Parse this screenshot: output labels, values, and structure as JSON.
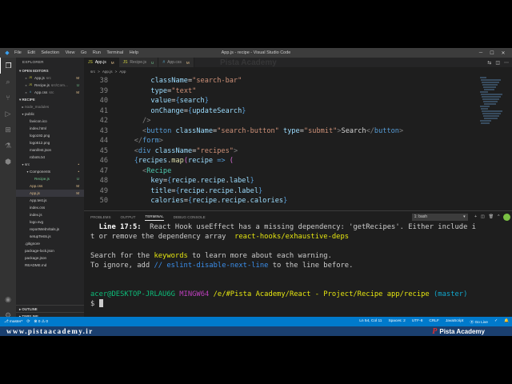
{
  "titlebar": {
    "menu": [
      "File",
      "Edit",
      "Selection",
      "View",
      "Go",
      "Run",
      "Terminal",
      "Help"
    ],
    "title": "App.js - recipe - Visual Studio Code"
  },
  "sidebar": {
    "header": "EXPLORER",
    "open_editors": {
      "title": "OPEN EDITORS",
      "items": [
        {
          "name": "App.js",
          "hint": "src",
          "badge": "M",
          "icon": "js"
        },
        {
          "name": "Recipe.js",
          "hint": "src\\Com...",
          "badge": "U",
          "icon": "js"
        },
        {
          "name": "App.css",
          "hint": "src",
          "badge": "M",
          "icon": "css"
        }
      ]
    },
    "project": {
      "title": "RECIPE",
      "items": [
        {
          "name": "node_modules",
          "type": "folder",
          "depth": 1
        },
        {
          "name": "public",
          "type": "folder-open",
          "depth": 1
        },
        {
          "name": "favicon.ico",
          "type": "file",
          "depth": 2
        },
        {
          "name": "index.html",
          "type": "file",
          "depth": 2
        },
        {
          "name": "logo192.png",
          "type": "file",
          "depth": 2
        },
        {
          "name": "logo512.png",
          "type": "file",
          "depth": 2
        },
        {
          "name": "manifest.json",
          "type": "file",
          "depth": 2
        },
        {
          "name": "robots.txt",
          "type": "file",
          "depth": 2
        },
        {
          "name": "src",
          "type": "folder-open",
          "depth": 1,
          "badge": "•"
        },
        {
          "name": "Components",
          "type": "folder-open",
          "depth": 2,
          "badge": "•"
        },
        {
          "name": "Recipe.js",
          "type": "file",
          "depth": 3,
          "badge": "U"
        },
        {
          "name": "App.css",
          "type": "file",
          "depth": 2,
          "badge": "M"
        },
        {
          "name": "App.js",
          "type": "file",
          "depth": 2,
          "badge": "M",
          "selected": true
        },
        {
          "name": "App.test.js",
          "type": "file",
          "depth": 2
        },
        {
          "name": "index.css",
          "type": "file",
          "depth": 2
        },
        {
          "name": "index.js",
          "type": "file",
          "depth": 2
        },
        {
          "name": "logo.svg",
          "type": "file",
          "depth": 2
        },
        {
          "name": "reportWebVitals.js",
          "type": "file",
          "depth": 2
        },
        {
          "name": "setupTests.js",
          "type": "file",
          "depth": 2
        },
        {
          "name": ".gitignore",
          "type": "file",
          "depth": 1
        },
        {
          "name": "package-lock.json",
          "type": "file",
          "depth": 1
        },
        {
          "name": "package.json",
          "type": "file",
          "depth": 1
        },
        {
          "name": "README.md",
          "type": "file",
          "depth": 1
        }
      ]
    },
    "bottom_sections": [
      "OUTLINE",
      "TIMELINE",
      "NPM SCRIPTS"
    ]
  },
  "tabs": [
    {
      "label": "App.js",
      "status": "M",
      "icon": "js",
      "active": true
    },
    {
      "label": "Recipe.js",
      "status": "U",
      "icon": "js",
      "active": false
    },
    {
      "label": "App.css",
      "status": "M",
      "icon": "css",
      "active": false
    }
  ],
  "watermark": "Pista Academy",
  "breadcrumb": [
    "src",
    ">",
    "App.js",
    ">",
    "App"
  ],
  "editor": {
    "lines": [
      {
        "n": "38",
        "tokens": [
          [
            "",
            "        "
          ],
          [
            "c-attr",
            "className"
          ],
          [
            "c-text",
            "="
          ],
          [
            "c-str",
            "\"search-bar\""
          ]
        ]
      },
      {
        "n": "39",
        "tokens": [
          [
            "",
            "        "
          ],
          [
            "c-attr",
            "type"
          ],
          [
            "c-text",
            "="
          ],
          [
            "c-str",
            "\"text\""
          ]
        ]
      },
      {
        "n": "40",
        "tokens": [
          [
            "",
            "        "
          ],
          [
            "c-attr",
            "value"
          ],
          [
            "c-text",
            "="
          ],
          [
            "c-html",
            "{"
          ],
          [
            "c-attr",
            "search"
          ],
          [
            "c-html",
            "}"
          ]
        ]
      },
      {
        "n": "41",
        "tokens": [
          [
            "",
            "        "
          ],
          [
            "c-attr",
            "onChange"
          ],
          [
            "c-text",
            "="
          ],
          [
            "c-html",
            "{"
          ],
          [
            "c-attr",
            "updateSearch"
          ],
          [
            "c-html",
            "}"
          ]
        ]
      },
      {
        "n": "42",
        "tokens": [
          [
            "",
            "      "
          ],
          [
            "c-punc",
            "/>"
          ]
        ]
      },
      {
        "n": "43",
        "tokens": [
          [
            "",
            "      "
          ],
          [
            "c-punc",
            "<"
          ],
          [
            "c-html",
            "button"
          ],
          [
            "c-text",
            " "
          ],
          [
            "c-attr",
            "className"
          ],
          [
            "c-text",
            "="
          ],
          [
            "c-str",
            "\"search-button\""
          ],
          [
            "c-text",
            " "
          ],
          [
            "c-attr",
            "type"
          ],
          [
            "c-text",
            "="
          ],
          [
            "c-str",
            "\"submit\""
          ],
          [
            "c-punc",
            ">"
          ],
          [
            "c-text",
            "Search"
          ],
          [
            "c-punc",
            "</"
          ],
          [
            "c-html",
            "button"
          ],
          [
            "c-punc",
            ">"
          ]
        ]
      },
      {
        "n": "44",
        "tokens": [
          [
            "",
            "    "
          ],
          [
            "c-punc",
            "</"
          ],
          [
            "c-html",
            "form"
          ],
          [
            "c-punc",
            ">"
          ]
        ]
      },
      {
        "n": "45",
        "tokens": [
          [
            "",
            "    "
          ],
          [
            "c-punc",
            "<"
          ],
          [
            "c-html",
            "div"
          ],
          [
            "c-text",
            " "
          ],
          [
            "c-attr",
            "className"
          ],
          [
            "c-text",
            "="
          ],
          [
            "c-str",
            "\"recipes\""
          ],
          [
            "c-punc",
            ">"
          ]
        ]
      },
      {
        "n": "46",
        "tokens": [
          [
            "",
            "    "
          ],
          [
            "c-html",
            "{"
          ],
          [
            "c-attr",
            "recipes"
          ],
          [
            "c-text",
            "."
          ],
          [
            "c-fn",
            "map"
          ],
          [
            "c-brace",
            "("
          ],
          [
            "c-attr",
            "recipe"
          ],
          [
            "c-text",
            " "
          ],
          [
            "c-html",
            "=>"
          ],
          [
            "c-text",
            " "
          ],
          [
            "c-brace",
            "("
          ]
        ]
      },
      {
        "n": "47",
        "tokens": [
          [
            "",
            "      "
          ],
          [
            "c-punc",
            "<"
          ],
          [
            "c-tag",
            "Recipe"
          ]
        ]
      },
      {
        "n": "48",
        "tokens": [
          [
            "",
            "        "
          ],
          [
            "c-attr",
            "key"
          ],
          [
            "c-text",
            "="
          ],
          [
            "c-html",
            "{"
          ],
          [
            "c-attr",
            "recipe"
          ],
          [
            "c-text",
            "."
          ],
          [
            "c-attr",
            "recipe"
          ],
          [
            "c-text",
            "."
          ],
          [
            "c-attr",
            "label"
          ],
          [
            "c-html",
            "}"
          ]
        ]
      },
      {
        "n": "49",
        "tokens": [
          [
            "",
            "        "
          ],
          [
            "c-attr",
            "title"
          ],
          [
            "c-text",
            "="
          ],
          [
            "c-html",
            "{"
          ],
          [
            "c-attr",
            "recipe"
          ],
          [
            "c-text",
            "."
          ],
          [
            "c-attr",
            "recipe"
          ],
          [
            "c-text",
            "."
          ],
          [
            "c-attr",
            "label"
          ],
          [
            "c-html",
            "}"
          ]
        ]
      },
      {
        "n": "50",
        "tokens": [
          [
            "",
            "        "
          ],
          [
            "c-attr",
            "calories"
          ],
          [
            "c-text",
            "="
          ],
          [
            "c-html",
            "{"
          ],
          [
            "c-attr",
            "recipe"
          ],
          [
            "c-text",
            "."
          ],
          [
            "c-attr",
            "recipe"
          ],
          [
            "c-text",
            "."
          ],
          [
            "c-attr",
            "calories"
          ],
          [
            "c-html",
            "}"
          ]
        ]
      }
    ]
  },
  "panel": {
    "tabs": [
      "PROBLEMS",
      "OUTPUT",
      "TERMINAL",
      "DEBUG CONSOLE"
    ],
    "active_tab": "TERMINAL",
    "terminal_select": "1: bash",
    "terminal": [
      [
        [
          "t-bold",
          "  Line 17:5:  "
        ],
        [
          "",
          "React Hook useEffect has a missing dependency: 'getRecipes'. Either include i"
        ]
      ],
      [
        [
          "",
          "t or remove the dependency array  "
        ],
        [
          "t-yel",
          "react-hooks/exhaustive-deps"
        ]
      ],
      [
        [
          "",
          ""
        ]
      ],
      [
        [
          "",
          "Search for the "
        ],
        [
          "t-yel",
          "keywords"
        ],
        [
          "",
          " to learn more about each warning."
        ]
      ],
      [
        [
          "",
          "To ignore, add "
        ],
        [
          "t-dim",
          "// eslint-disable-next-line"
        ],
        [
          "",
          " to the line before."
        ]
      ],
      [
        [
          "",
          ""
        ]
      ],
      [
        [
          "",
          ""
        ]
      ],
      [
        [
          "t-green",
          "acer@DESKTOP-JRLAU6G"
        ],
        [
          "",
          " "
        ],
        [
          "t-mag",
          "MINGW64"
        ],
        [
          "",
          " "
        ],
        [
          "t-yel",
          "/e/#Pista Academy/React - Project/Recipe app/recipe"
        ],
        [
          "",
          " "
        ],
        [
          "t-cyan",
          "(master)"
        ]
      ],
      [
        [
          "",
          "$ "
        ]
      ]
    ]
  },
  "statusbar": {
    "left": [
      "⎇ master*",
      "⟳",
      "⊗ 0 ⚠ 0"
    ],
    "right": [
      "Ln 54, Col 11",
      "Spaces: 2",
      "UTF-8",
      "CRLF",
      "JavaScript",
      "⦿ Go Live",
      "✓",
      "🔔"
    ]
  },
  "footer": {
    "site": "www.pistaacademy.ir",
    "brand_letter": "P",
    "brand": "Pista Academy"
  },
  "colors": {
    "statusbar": "#007acc",
    "footer": "#1a3f6f",
    "editor_bg": "#1e1e1e"
  }
}
